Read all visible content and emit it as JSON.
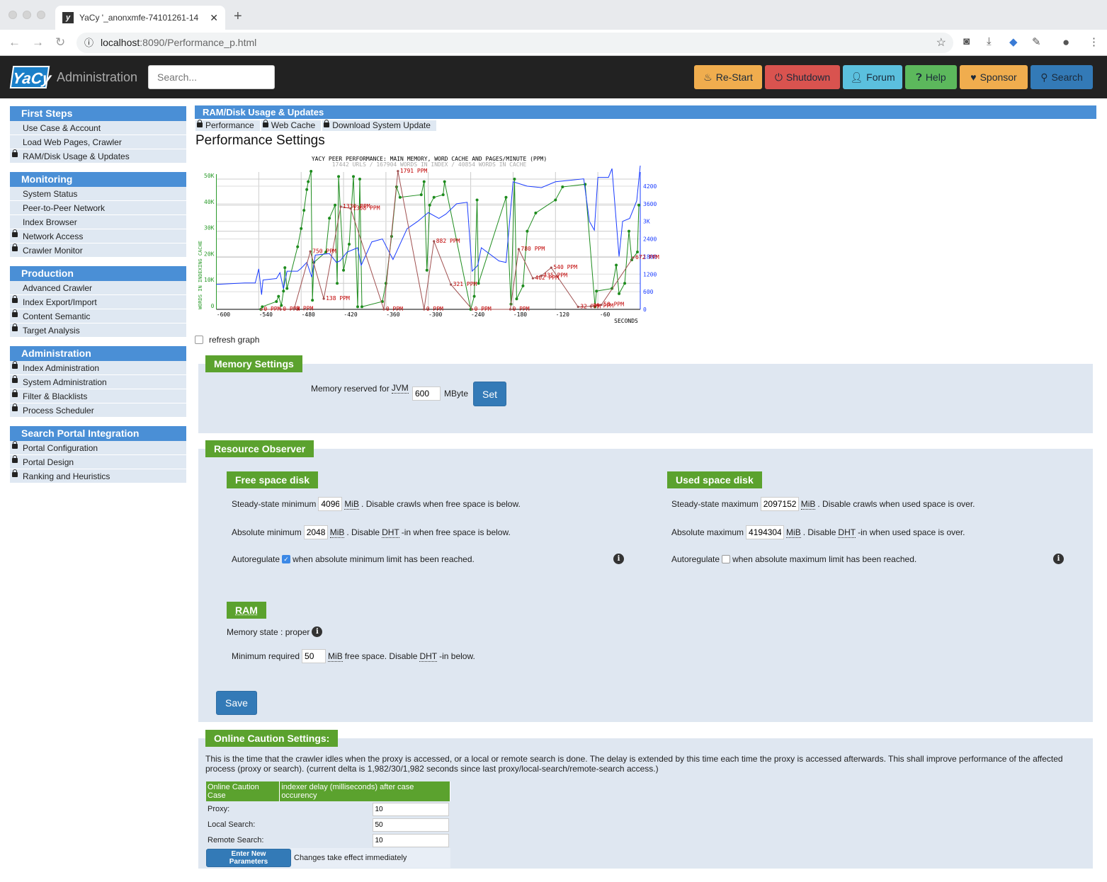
{
  "browser": {
    "tab_title": "YaCy '_anonxmfe-74101261-14",
    "url_host": "localhost",
    "url_path": ":8090/Performance_p.html"
  },
  "header": {
    "title": "Administration",
    "search_placeholder": "Search...",
    "buttons": [
      {
        "label": "Re-Start",
        "icon": "fire-icon",
        "color": "#f0ad4e"
      },
      {
        "label": "Shutdown",
        "icon": "power-icon",
        "color": "#d9534f"
      },
      {
        "label": "Forum",
        "icon": "user-icon",
        "color": "#5bc0de"
      },
      {
        "label": "Help",
        "icon": "question-circle-icon",
        "color": "#5cb85c"
      },
      {
        "label": "Sponsor",
        "icon": "heart-icon",
        "color": "#f0ad4e"
      },
      {
        "label": "Search",
        "icon": "search-icon",
        "color": "#337ab7"
      }
    ]
  },
  "sidebar": [
    {
      "title": "First Steps",
      "items": [
        {
          "label": "Use Case & Account",
          "locked": false
        },
        {
          "label": "Load Web Pages, Crawler",
          "locked": false
        },
        {
          "label": "RAM/Disk Usage & Updates",
          "locked": true
        }
      ]
    },
    {
      "title": "Monitoring",
      "items": [
        {
          "label": "System Status",
          "locked": false
        },
        {
          "label": "Peer-to-Peer Network",
          "locked": false
        },
        {
          "label": "Index Browser",
          "locked": false
        },
        {
          "label": "Network Access",
          "locked": true
        },
        {
          "label": "Crawler Monitor",
          "locked": true
        }
      ]
    },
    {
      "title": "Production",
      "items": [
        {
          "label": "Advanced Crawler",
          "locked": false
        },
        {
          "label": "Index Export/Import",
          "locked": true
        },
        {
          "label": "Content Semantic",
          "locked": true
        },
        {
          "label": "Target Analysis",
          "locked": true
        }
      ]
    },
    {
      "title": "Administration",
      "items": [
        {
          "label": "Index Administration",
          "locked": true
        },
        {
          "label": "System Administration",
          "locked": true
        },
        {
          "label": "Filter & Blacklists",
          "locked": true
        },
        {
          "label": "Process Scheduler",
          "locked": true
        }
      ]
    },
    {
      "title": "Search Portal Integration",
      "items": [
        {
          "label": "Portal Configuration",
          "locked": true
        },
        {
          "label": "Portal Design",
          "locked": true
        },
        {
          "label": "Ranking and Heuristics",
          "locked": true
        }
      ]
    }
  ],
  "page": {
    "heading": "RAM/Disk Usage & Updates",
    "subtabs": [
      "Performance",
      "Web Cache",
      "Download System Update"
    ],
    "title": "Performance Settings",
    "refresh_label": "refresh graph"
  },
  "chart_data": {
    "type": "line",
    "title": "YACY PEER PERFORMANCE: MAIN MEMORY, WORD CACHE AND PAGES/MINUTE (PPM)",
    "subtitle": "17442 URLS / 167904 WORDS IN INDEX / 40854 WORDS IN CACHE",
    "xlabel": "SECONDS",
    "ylabel": "WORDS IN INDEXING CACHE",
    "xlim": [
      -600,
      0
    ],
    "ylim_left": [
      0,
      50000
    ],
    "ylim_right": [
      0,
      4200
    ],
    "x_ticks": [
      "-600",
      "-540",
      "-480",
      "-420",
      "-360",
      "-300",
      "-240",
      "-180",
      "-120",
      "-60"
    ],
    "y_ticks_left": [
      "0",
      "10K",
      "20K",
      "30K",
      "40K",
      "50K"
    ],
    "y_ticks_right": [
      "600",
      "1200",
      "1800",
      "2400",
      "3K",
      "3600",
      "4200"
    ],
    "grid": true,
    "series": [
      {
        "color": "#1e8c1e",
        "values": [
          [
            -537,
            0
          ],
          [
            -535,
            1000
          ],
          [
            -515,
            3000
          ],
          [
            -512,
            5000
          ],
          [
            -508,
            1500
          ],
          [
            -505,
            7000
          ],
          [
            -503,
            16000
          ],
          [
            -500,
            8000
          ],
          [
            -485,
            24000
          ],
          [
            -480,
            31000
          ],
          [
            -476,
            38000
          ],
          [
            -472,
            46000
          ],
          [
            -470,
            49000
          ],
          [
            -466,
            53000
          ],
          [
            -464,
            3500
          ],
          [
            -462,
            18000
          ],
          [
            -445,
            22000
          ],
          [
            -440,
            35000
          ],
          [
            -432,
            40000
          ],
          [
            -429,
            10000
          ],
          [
            -427,
            51000
          ],
          [
            -420,
            15000
          ],
          [
            -412,
            25000
          ],
          [
            -406,
            51000
          ],
          [
            -400,
            1000
          ],
          [
            -397,
            50000
          ],
          [
            -394,
            1000
          ],
          [
            -365,
            3000
          ],
          [
            -360,
            10000
          ],
          [
            -352,
            28000
          ],
          [
            -345,
            47000
          ],
          [
            -340,
            43000
          ],
          [
            -310,
            44000
          ],
          [
            -306,
            49000
          ],
          [
            -302,
            15000
          ],
          [
            -298,
            40000
          ],
          [
            -292,
            43000
          ],
          [
            -279,
            44000
          ],
          [
            -277,
            49000
          ],
          [
            -240,
            0
          ],
          [
            -235,
            5000
          ],
          [
            -231,
            42000
          ],
          [
            -229,
            10000
          ],
          [
            -190,
            43000
          ],
          [
            -183,
            2000
          ],
          [
            -178,
            50000
          ],
          [
            -175,
            4000
          ],
          [
            -166,
            9000
          ],
          [
            -160,
            30000
          ],
          [
            -148,
            37000
          ],
          [
            -120,
            42000
          ],
          [
            -110,
            47000
          ],
          [
            -78,
            48000
          ],
          [
            -64,
            1000
          ],
          [
            -62,
            7000
          ],
          [
            -40,
            8000
          ],
          [
            -34,
            17000
          ],
          [
            -30,
            6000
          ],
          [
            -22,
            10000
          ],
          [
            -16,
            30000
          ],
          [
            -12,
            19000
          ],
          [
            -4,
            22000
          ],
          [
            -2,
            40000
          ]
        ]
      },
      {
        "color": "#1a3cff",
        "values": [
          [
            -600,
            850
          ],
          [
            -560,
            900
          ],
          [
            -545,
            900
          ],
          [
            -540,
            1380
          ],
          [
            -536,
            500
          ],
          [
            -534,
            1000
          ],
          [
            -515,
            1050
          ],
          [
            -510,
            1250
          ],
          [
            -505,
            700
          ],
          [
            -500,
            1300
          ],
          [
            -485,
            1300
          ],
          [
            -480,
            1400
          ],
          [
            -472,
            1600
          ],
          [
            -465,
            1100
          ],
          [
            -460,
            1850
          ],
          [
            -440,
            1900
          ],
          [
            -430,
            1600
          ],
          [
            -425,
            1650
          ],
          [
            -415,
            1950
          ],
          [
            -400,
            2100
          ],
          [
            -395,
            1500
          ],
          [
            -380,
            2300
          ],
          [
            -365,
            2400
          ],
          [
            -350,
            1700
          ],
          [
            -330,
            2750
          ],
          [
            -315,
            3000
          ],
          [
            -300,
            3300
          ],
          [
            -285,
            3100
          ],
          [
            -275,
            3250
          ],
          [
            -260,
            3600
          ],
          [
            -245,
            3650
          ],
          [
            -238,
            1300
          ],
          [
            -230,
            1500
          ],
          [
            -225,
            2100
          ],
          [
            -200,
            1650
          ],
          [
            -190,
            1600
          ],
          [
            -180,
            4350
          ],
          [
            -160,
            4200
          ],
          [
            -140,
            4150
          ],
          [
            -120,
            4350
          ],
          [
            -100,
            4400
          ],
          [
            -80,
            4450
          ],
          [
            -72,
            3000
          ],
          [
            -65,
            2700
          ],
          [
            -60,
            4500
          ],
          [
            -45,
            4500
          ],
          [
            -40,
            4800
          ],
          [
            -30,
            1800
          ],
          [
            -25,
            3000
          ],
          [
            -15,
            3100
          ],
          [
            -5,
            3700
          ],
          [
            0,
            4900
          ]
        ]
      },
      {
        "color": "#a05050",
        "values": [
          [
            -536,
            0,
            "0 PPM"
          ],
          [
            -509,
            0,
            "0 PPM"
          ],
          [
            -490,
            3,
            "3 PPM"
          ],
          [
            -467,
            750,
            "750 PPM"
          ],
          [
            -448,
            138,
            "138 PPM"
          ],
          [
            -424,
            1330,
            "1330 PPM"
          ],
          [
            -410,
            1308,
            "1308 PPM"
          ],
          [
            -363,
            0,
            "0 PPM"
          ],
          [
            -343,
            1791,
            "1791 PPM"
          ],
          [
            -306,
            0,
            "0 PPM"
          ],
          [
            -292,
            882,
            "882 PPM"
          ],
          [
            -268,
            321,
            "321 PPM"
          ],
          [
            -238,
            0,
            "0 PPM"
          ],
          [
            -184,
            0,
            "0 PPM"
          ],
          [
            -172,
            780,
            "780 PPM"
          ],
          [
            -152,
            402,
            "402 PPM"
          ],
          [
            -140,
            435,
            "435 PPM"
          ],
          [
            -126,
            540,
            "540 PPM"
          ],
          [
            -88,
            32,
            "32 PPM"
          ],
          [
            -70,
            39,
            "39 PPM"
          ],
          [
            -55,
            58,
            "58 PPM"
          ],
          [
            -10,
            672,
            "672 PPM"
          ]
        ]
      }
    ]
  },
  "memory": {
    "title": "Memory Settings",
    "label_pre": "Memory reserved for",
    "jvm": "JVM",
    "value": "600",
    "unit": "MByte",
    "set_label": "Set"
  },
  "observer": {
    "title": "Resource Observer",
    "free": {
      "title": "Free space disk",
      "steady_pre": "Steady-state minimum",
      "steady_value": "4096",
      "steady_post": ". Disable crawls when free space is below.",
      "abs_pre": "Absolute minimum",
      "abs_value": "2048",
      "abs_post_a": ". Disable ",
      "abs_post_b": "-in when free space is below.",
      "auto_pre": "Autoregulate",
      "auto_checked": true,
      "auto_post": "when absolute minimum limit has been reached."
    },
    "used": {
      "title": "Used space disk",
      "steady_pre": "Steady-state maximum",
      "steady_value": "2097152",
      "steady_post": ". Disable crawls when used space is over.",
      "abs_pre": "Absolute maximum",
      "abs_value": "4194304",
      "abs_post_a": ". Disable ",
      "abs_post_b": "-in when used space is over.",
      "auto_pre": "Autoregulate",
      "auto_checked": false,
      "auto_post": "when absolute maximum limit has been reached."
    },
    "mib": "MiB",
    "dht": "DHT",
    "ram": {
      "title": "RAM",
      "state": "Memory state : proper",
      "min_pre": "Minimum required",
      "min_value": "50",
      "min_post_a": " free space. Disable ",
      "min_post_b": "-in below."
    },
    "save_label": "Save"
  },
  "caution": {
    "title": "Online Caution Settings:",
    "description": "This is the time that the crawler idles when the proxy is accessed, or a local or remote search is done. The delay is extended by this time each time the proxy is accessed afterwards. This shall improve performance of the affected process (proxy or search). (current delta is 1,982/30/1,982 seconds since last proxy/local-search/remote-search access.)",
    "headers": [
      "Online Caution Case",
      "indexer delay (milliseconds) after case occurency"
    ],
    "rows": [
      {
        "label": "Proxy:",
        "value": "10"
      },
      {
        "label": "Local Search:",
        "value": "50"
      },
      {
        "label": "Remote Search:",
        "value": "10"
      }
    ],
    "button_label": "Enter New Parameters",
    "note": "Changes take effect immediately"
  }
}
